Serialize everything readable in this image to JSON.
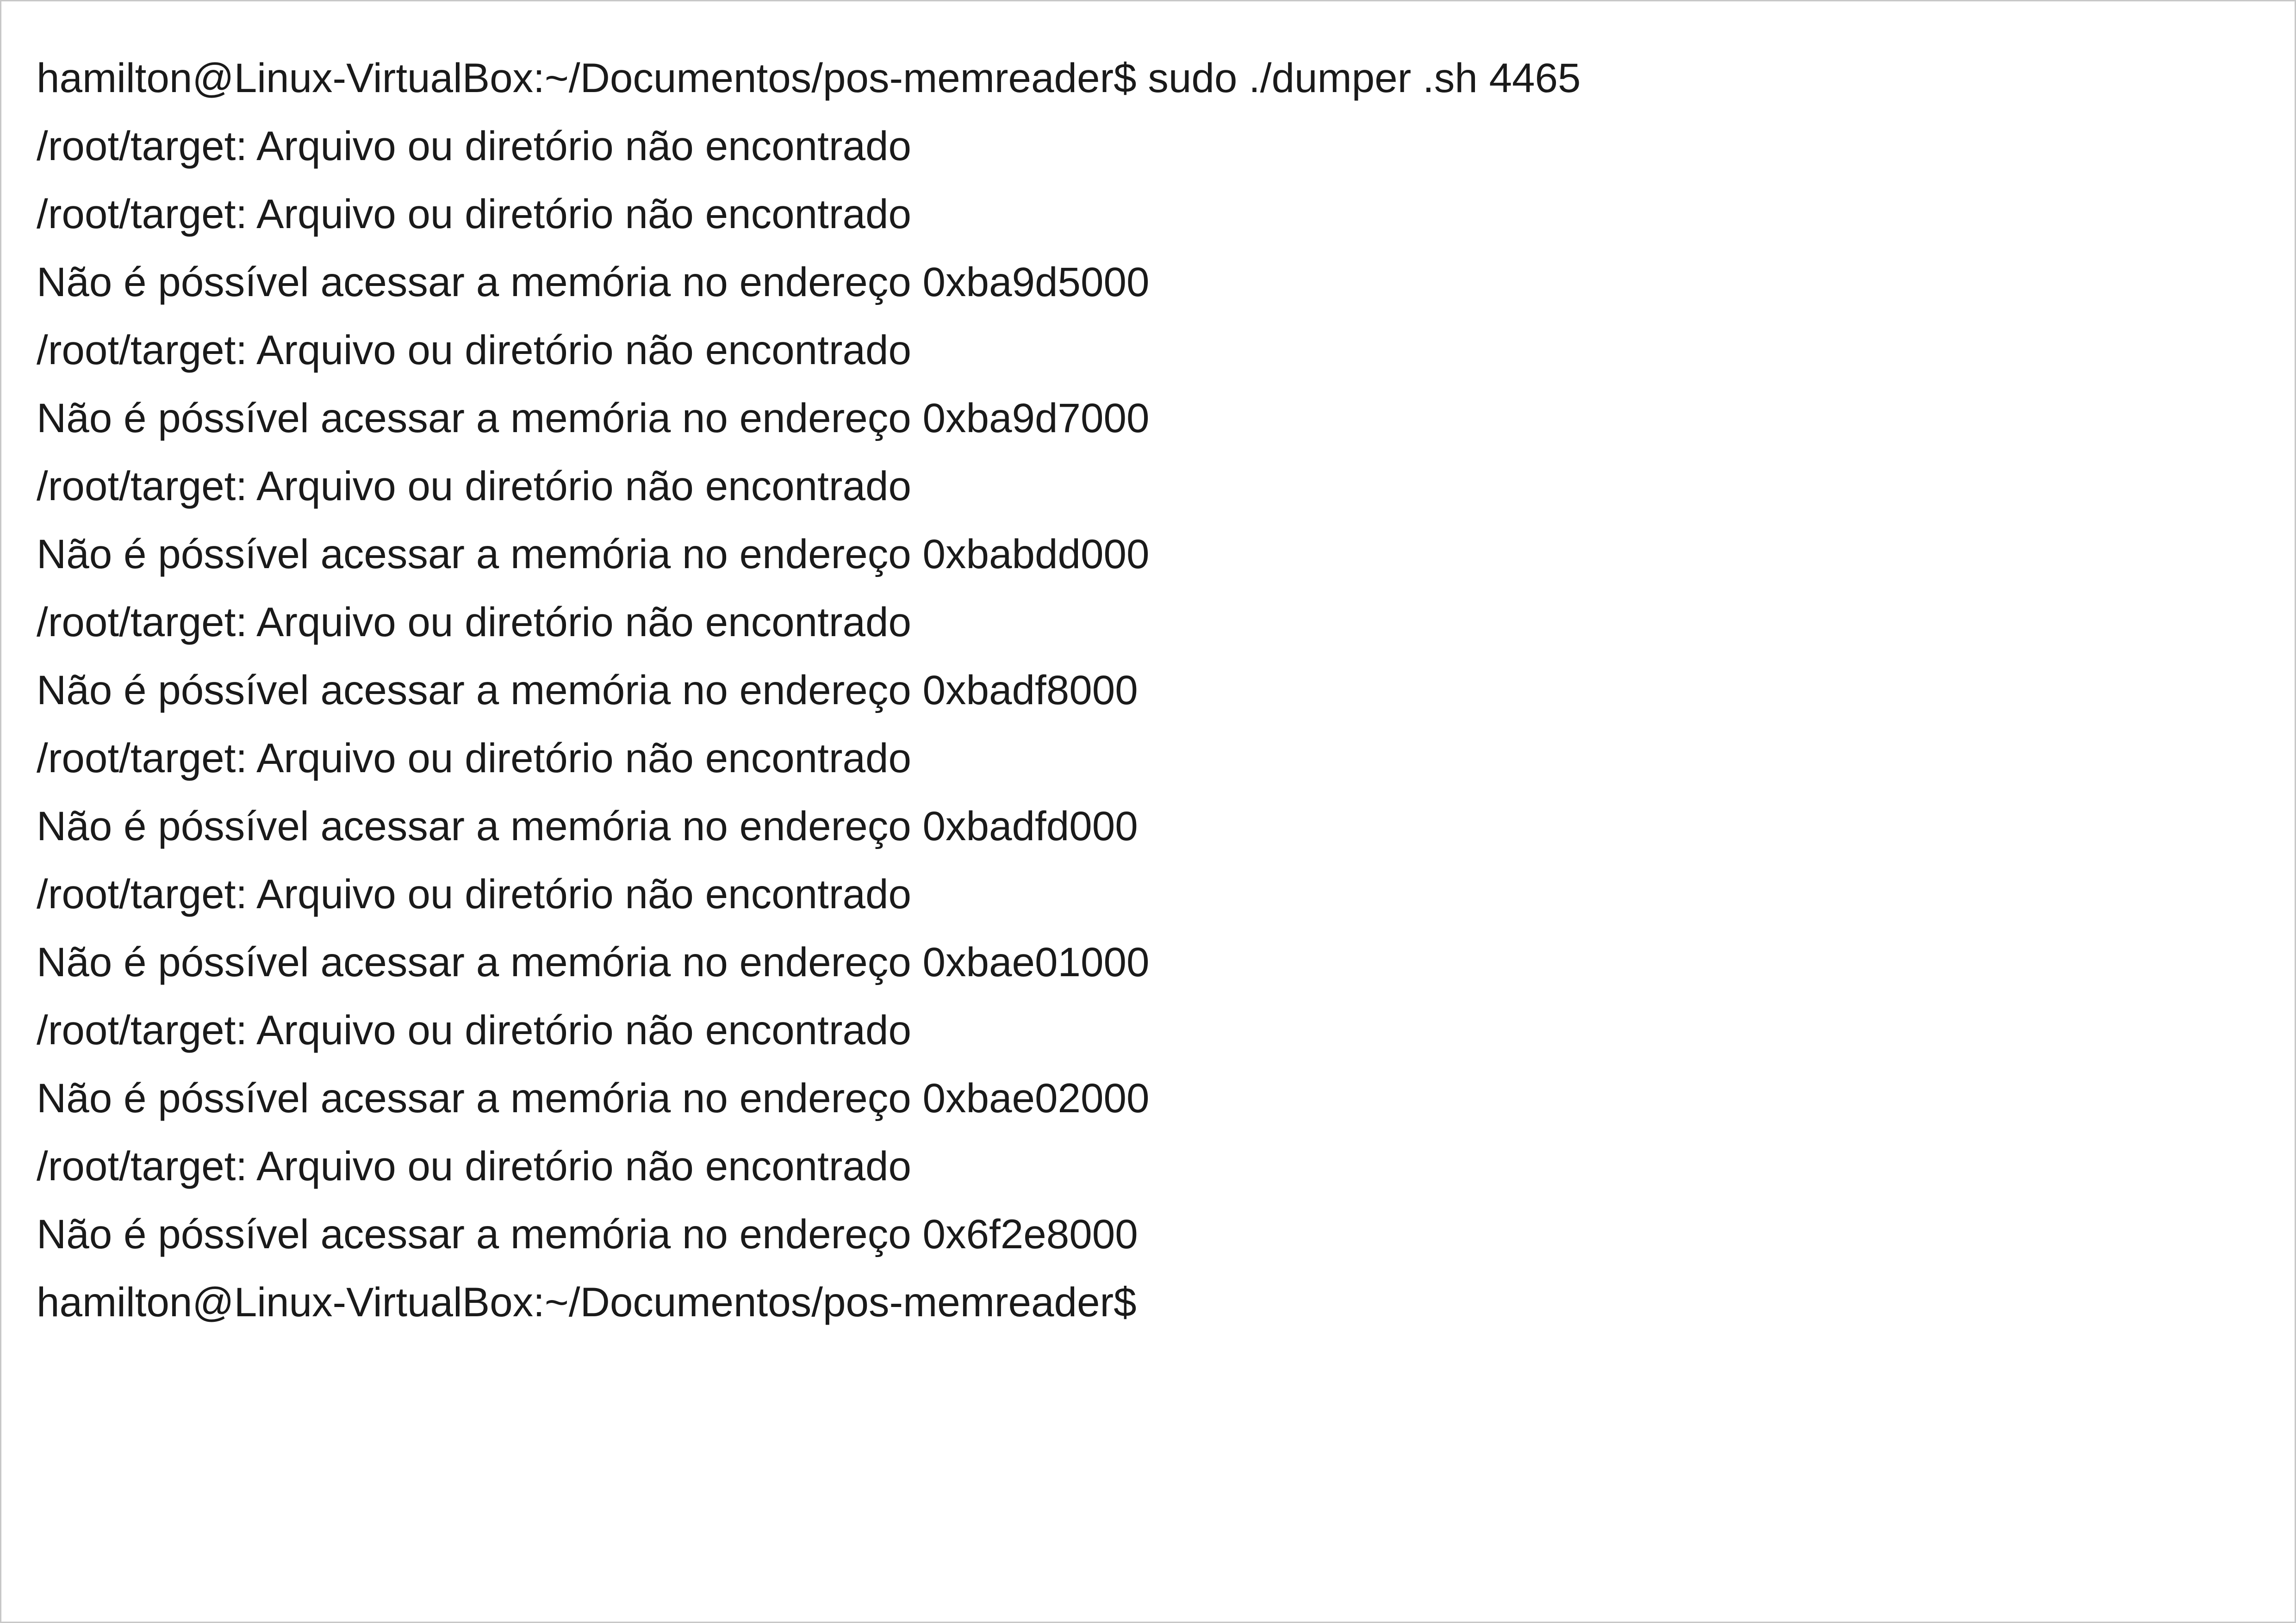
{
  "terminal": {
    "lines": [
      "hamilton@Linux-VirtualBox:~/Documentos/pos-memreader$ sudo ./dumper .sh 4465",
      "/root/target: Arquivo ou diretório não encontrado",
      "/root/target: Arquivo ou diretório não encontrado",
      "Não é póssível acessar a memória no endereço 0xba9d5000",
      "/root/target: Arquivo ou diretório não encontrado",
      "Não é póssível acessar a memória no endereço 0xba9d7000",
      "/root/target: Arquivo ou diretório não encontrado",
      "Não é póssível acessar a memória no endereço 0xbabdd000",
      "/root/target: Arquivo ou diretório não encontrado",
      "Não é póssível acessar a memória no endereço 0xbadf8000",
      "/root/target: Arquivo ou diretório não encontrado",
      "Não é póssível acessar a memória no endereço 0xbadfd000",
      "/root/target: Arquivo ou diretório não encontrado",
      "Não é póssível acessar a memória no endereço 0xbae01000",
      "/root/target: Arquivo ou diretório não encontrado",
      "Não é póssível acessar a memória no endereço 0xbae02000",
      "/root/target: Arquivo ou diretório não encontrado",
      "Não é póssível acessar a memória no endereço 0x6f2e8000",
      "hamilton@Linux-VirtualBox:~/Documentos/pos-memreader$"
    ]
  },
  "colors": {
    "background": "#ffffff",
    "text": "#1a1a1a",
    "border": "#c8c8c8"
  }
}
